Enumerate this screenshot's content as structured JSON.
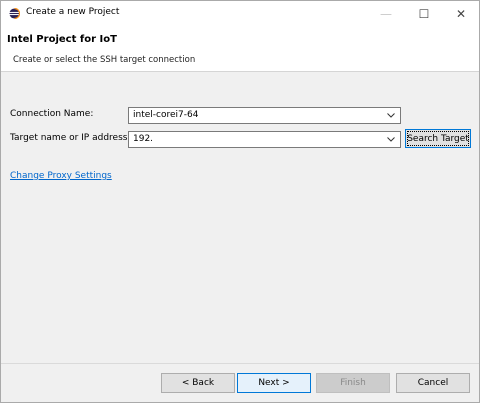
{
  "window": {
    "title": "Create a new Project",
    "minimize_glyph": "—",
    "maximize_glyph": "☐",
    "close_glyph": "✕"
  },
  "header": {
    "title": "Intel Project for IoT",
    "description": "Create or select the SSH target connection"
  },
  "form": {
    "connection_label": "Connection Name:",
    "connection_value": "intel-corei7-64",
    "target_label": "Target name or IP address:",
    "target_value": "192.",
    "search_button": "Search Target",
    "proxy_link": "Change Proxy Settings"
  },
  "footer": {
    "back": "< Back",
    "next": "Next >",
    "finish": "Finish",
    "cancel": "Cancel"
  },
  "icons": {
    "app": "eclipse-icon",
    "dropdown": "chevron-down-icon"
  },
  "colors": {
    "link": "#0066cc",
    "focus_border": "#0078d7",
    "dialog_bg": "#f0f0f0"
  }
}
